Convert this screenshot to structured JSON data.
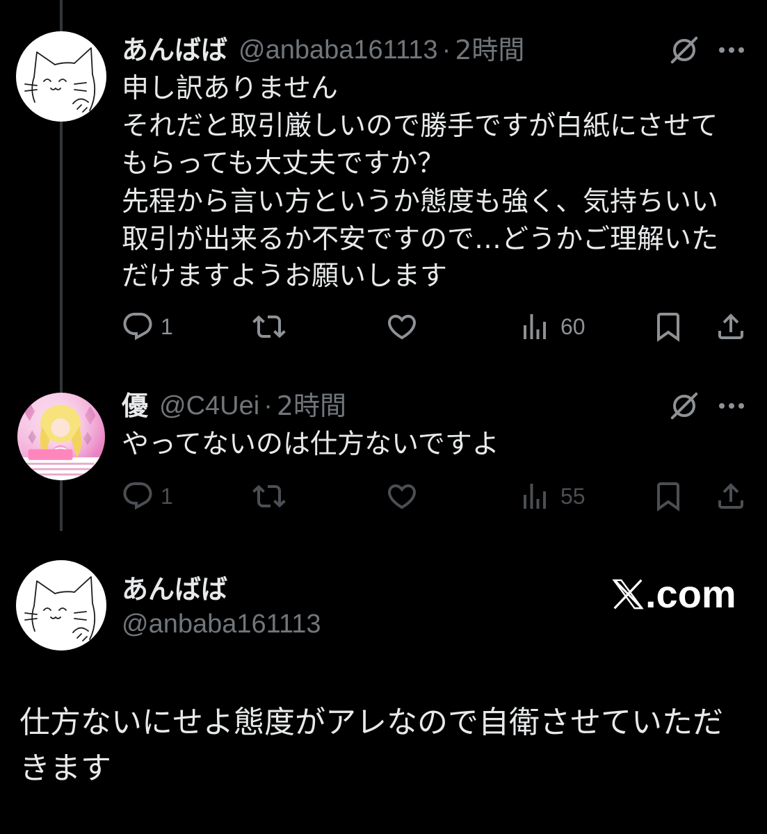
{
  "colors": {
    "background": "#000000",
    "text": "#e7e9ea",
    "muted": "#71767b",
    "thread_line": "#333639",
    "action_active": "#8e9296",
    "action_dim": "#4b4f53",
    "watermark": "#ffffff"
  },
  "thread": {
    "replies": [
      {
        "display_name": "あんばば",
        "handle": "@anbaba161113",
        "separator": "·",
        "time": "2時間",
        "body_lines": [
          "申し訳ありません",
          "それだと取引厳しいので勝手ですが白紙にさせて",
          "もらっても大丈夫ですか？",
          "先程から言い方というか態度も強く、気持ちいい",
          "取引が出来るか不安ですので…どうかご理解いた",
          "だけますようお願いします"
        ],
        "actions": {
          "reply_count": "1",
          "view_count": "60"
        }
      },
      {
        "display_name": "優",
        "handle": "@C4Uei",
        "separator": "·",
        "time": "2時間",
        "body_lines": [
          "やってないのは仕方ないですよ"
        ],
        "actions": {
          "reply_count": "1",
          "view_count": "55"
        }
      }
    ]
  },
  "main_post": {
    "display_name": "あんばば",
    "handle": "@anbaba161113",
    "body_lines": [
      "仕方ないにせよ態度がアレなので自衛させていただ",
      "きます"
    ]
  },
  "watermark": {
    "suffix": ".com"
  },
  "icons": {
    "reply": "reply-icon",
    "retweet": "retweet-icon",
    "like": "heart-icon",
    "views": "views-icon",
    "bookmark": "bookmark-icon",
    "share": "share-icon",
    "grok": "grok-icon",
    "more": "more-icon",
    "brand": "x-logo-icon"
  }
}
